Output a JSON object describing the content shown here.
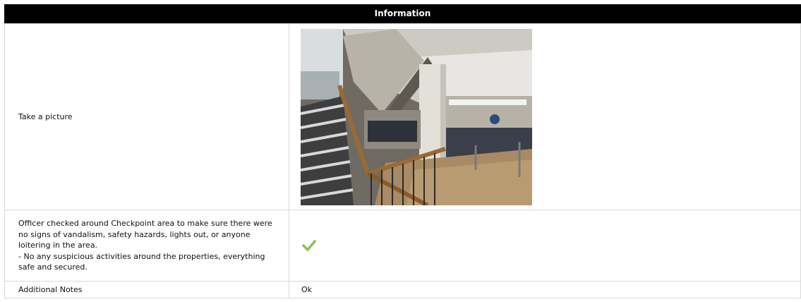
{
  "header": {
    "title": "Information"
  },
  "rows": [
    {
      "label": "Take a picture",
      "photo_alt": "Take a picture"
    },
    {
      "label": "Officer checked around Checkpoint area to make sure there were no signs of vandalism, safety hazards, lights out, or anyone loitering in the area.\n- No any suspicious activities around the properties, everything safe and secured.",
      "value_icon": "checkmark-icon",
      "check_color": "#8bc34a"
    },
    {
      "label": "Additional Notes",
      "value": "Ok"
    }
  ]
}
